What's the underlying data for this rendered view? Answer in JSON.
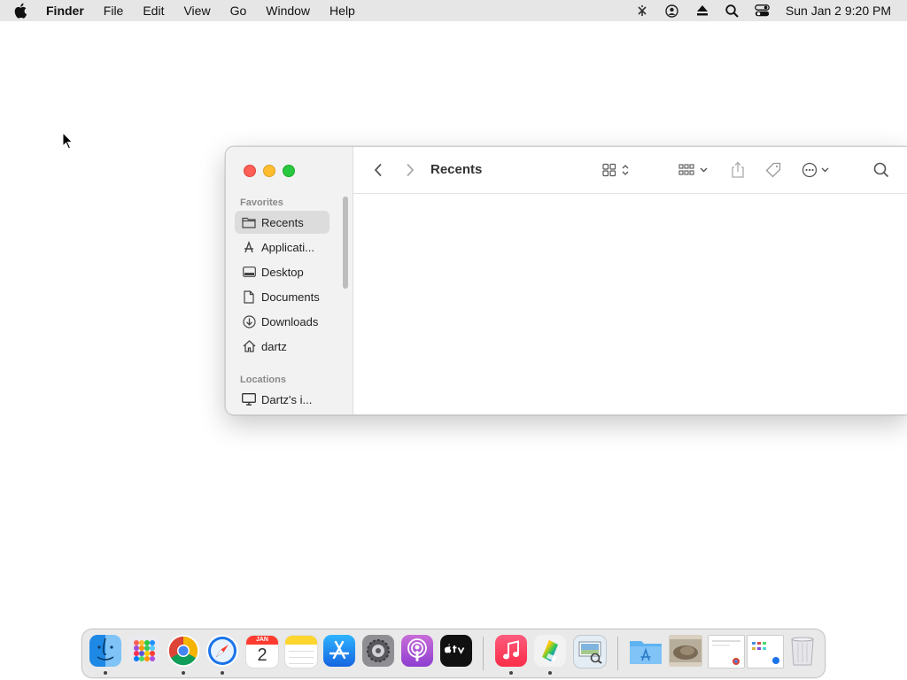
{
  "menubar": {
    "app_name": "Finder",
    "menus": [
      "File",
      "Edit",
      "View",
      "Go",
      "Window",
      "Help"
    ],
    "status_icons": [
      "wifi-icon",
      "user-icon",
      "eject-icon",
      "spotlight-icon",
      "control-center-icon"
    ],
    "clock": "Sun Jan 2  9:20 PM"
  },
  "finder": {
    "title": "Recents",
    "sidebar": {
      "favorites_label": "Favorites",
      "items": [
        {
          "label": "Recents",
          "icon": "clock-folder-icon",
          "selected": true
        },
        {
          "label": "Applicati...",
          "icon": "applications-icon"
        },
        {
          "label": "Desktop",
          "icon": "desktop-icon"
        },
        {
          "label": "Documents",
          "icon": "document-icon"
        },
        {
          "label": "Downloads",
          "icon": "download-icon"
        },
        {
          "label": "dartz",
          "icon": "home-icon"
        }
      ],
      "locations_label": "Locations",
      "location_items": [
        {
          "label": "Dartz's i...",
          "icon": "computer-icon"
        }
      ]
    },
    "toolbar": {
      "icons": [
        "back-icon",
        "forward-icon",
        "view-grid-icon",
        "group-icon",
        "share-icon",
        "tag-icon",
        "more-icon",
        "search-icon"
      ]
    }
  },
  "dock": {
    "calendar_month": "JAN",
    "calendar_day": "2",
    "apps": [
      "Finder",
      "Launchpad",
      "Chrome",
      "Safari",
      "Calendar",
      "Notes",
      "App Store",
      "System Preferences",
      "Podcasts",
      "TV",
      "Music",
      "Color Picker",
      "Preview"
    ],
    "colors": {
      "finder": "#1e88e5",
      "safari": "#1a73e8",
      "podcasts": "#a24bd8",
      "music": "#fa2d48",
      "appstore": "#1e90ff"
    }
  }
}
